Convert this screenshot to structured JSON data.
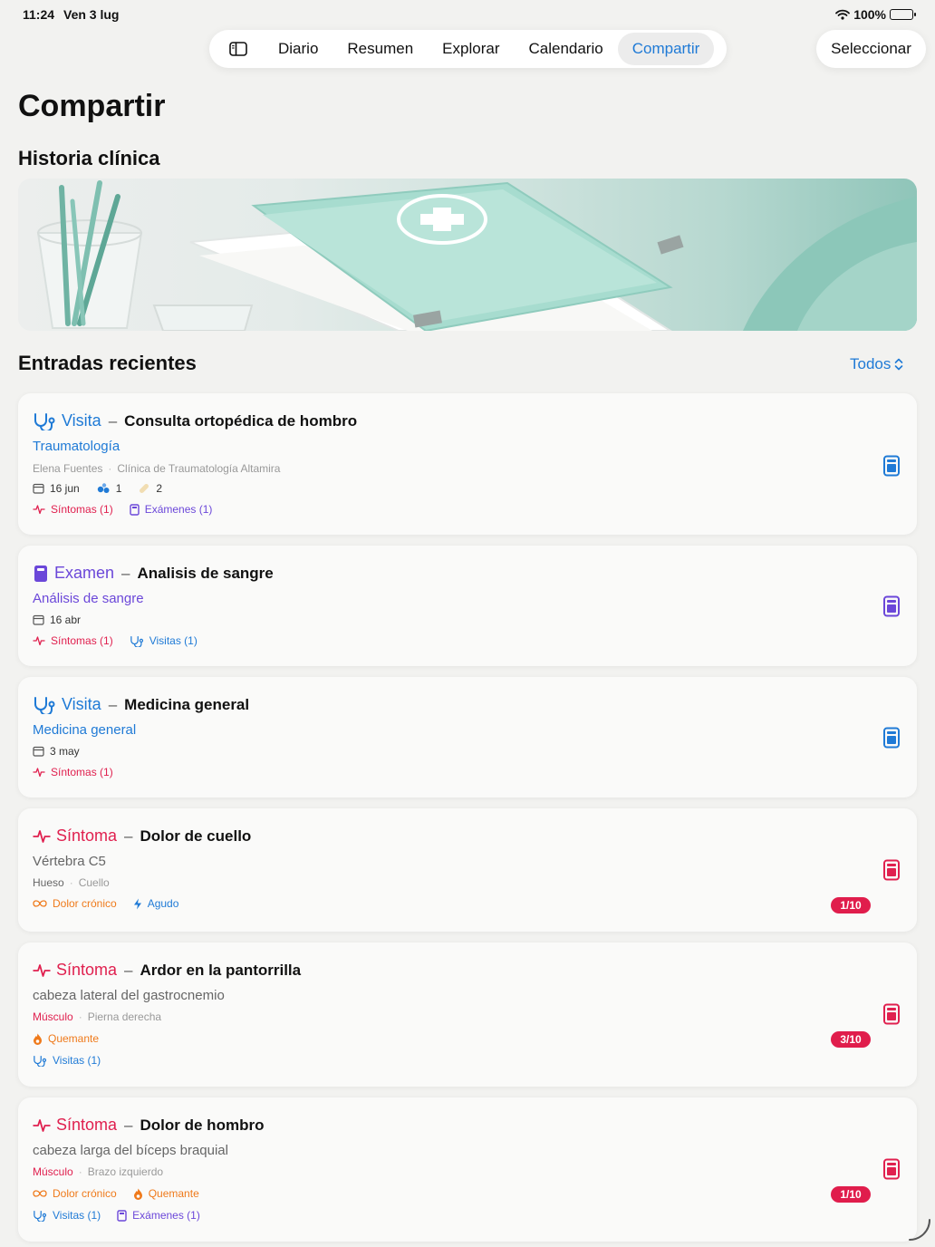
{
  "status": {
    "time": "11:24",
    "date": "Ven 3 lug",
    "battery": "100%"
  },
  "tabs": [
    {
      "label": "Diario"
    },
    {
      "label": "Resumen"
    },
    {
      "label": "Explorar"
    },
    {
      "label": "Calendario"
    },
    {
      "label": "Compartir",
      "active": true
    }
  ],
  "select_label": "Seleccionar",
  "page_title": "Compartir",
  "section_title": "Historia clínica",
  "recent_title": "Entradas recientes",
  "filter_label": "Todos",
  "colors": {
    "accent": "#1f7ad6",
    "visit": "#1f7ad6",
    "exam": "#6b47d9",
    "symptom": "#e0204f",
    "chronic": "#ef7a1b"
  },
  "cards": [
    {
      "kind": "Visita",
      "title": "Consulta ortopédica de hombro",
      "subtitle": "Traumatología",
      "meta_a": "Elena Fuentes",
      "meta_b": "Clínica de Traumatología Altamira",
      "date": "16 jun",
      "meds": "1",
      "bandages": "2",
      "link1": "Síntomas (1)",
      "link2": "Exámenes (1)"
    },
    {
      "kind": "Examen",
      "title": "Analisis de sangre",
      "subtitle": "Análisis de sangre",
      "date": "16 abr",
      "link1": "Síntomas (1)",
      "link2": "Visitas (1)"
    },
    {
      "kind": "Visita",
      "title": "Medicina general",
      "subtitle": "Medicina general",
      "date": "3 may",
      "link1": "Síntomas (1)"
    },
    {
      "kind": "Síntoma",
      "title": "Dolor de cuello",
      "subtitle": "Vértebra C5",
      "meta_a": "Hueso",
      "meta_b": "Cuello",
      "tag1": "Dolor crónico",
      "tag2": "Agudo",
      "score": "1/10"
    },
    {
      "kind": "Síntoma",
      "title": "Ardor en la pantorrilla",
      "subtitle": "cabeza lateral del gastrocnemio",
      "meta_a": "Músculo",
      "meta_b": "Pierna derecha",
      "tag1": "Quemante",
      "link1": "Visitas (1)",
      "score": "3/10"
    },
    {
      "kind": "Síntoma",
      "title": "Dolor de hombro",
      "subtitle": "cabeza larga del bíceps braquial",
      "meta_a": "Músculo",
      "meta_b": "Brazo izquierdo",
      "tag1": "Dolor crónico",
      "tag2": "Quemante",
      "link1": "Visitas (1)",
      "link2": "Exámenes (1)",
      "score": "1/10"
    }
  ]
}
